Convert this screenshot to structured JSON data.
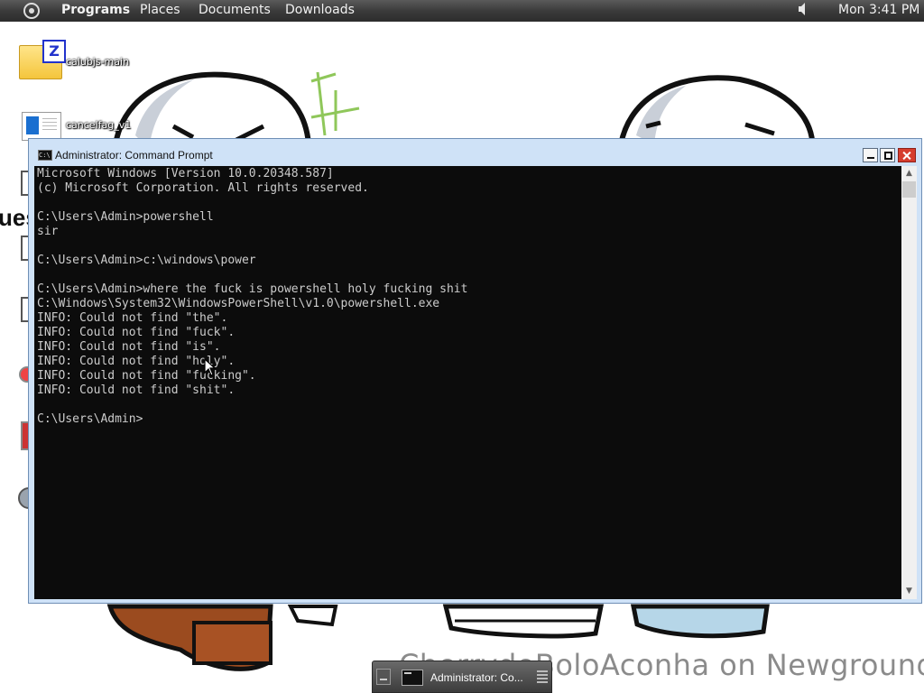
{
  "top_panel": {
    "menus": [
      "Programs",
      "Places",
      "Documents",
      "Downloads"
    ],
    "clock": "Mon 3:41 PM",
    "icons": {
      "logo": "circle-logo-icon",
      "volume": "speaker-icon"
    }
  },
  "desktop": {
    "icons": [
      {
        "label": "calubjs-main",
        "icon": "folder-zip-icon"
      },
      {
        "label": "cancelfag_v1",
        "icon": "document-icon"
      }
    ],
    "wallpaper_partial_text": "ues",
    "watermark": "CherrydoBoloAconha on Newgrounds."
  },
  "window": {
    "title": "Administrator: Command Prompt",
    "console_lines": [
      "Microsoft Windows [Version 10.0.20348.587]",
      "(c) Microsoft Corporation. All rights reserved.",
      "",
      "C:\\Users\\Admin>powershell",
      "sir",
      "",
      "C:\\Users\\Admin>c:\\windows\\power",
      "",
      "C:\\Users\\Admin>where the fuck is powershell holy fucking shit",
      "C:\\Windows\\System32\\WindowsPowerShell\\v1.0\\powershell.exe",
      "INFO: Could not find \"the\".",
      "INFO: Could not find \"fuck\".",
      "INFO: Could not find \"is\".",
      "INFO: Could not find \"holy\".",
      "INFO: Could not find \"fucking\".",
      "INFO: Could not find \"shit\".",
      "",
      "C:\\Users\\Admin>"
    ],
    "colors": {
      "console_bg": "#0c0c0c",
      "console_fg": "#cccccc",
      "frame": "#cfe2f7",
      "close": "#d63d2e"
    }
  },
  "taskbar": {
    "items": [
      {
        "label": "Administrator: Co..."
      }
    ]
  }
}
